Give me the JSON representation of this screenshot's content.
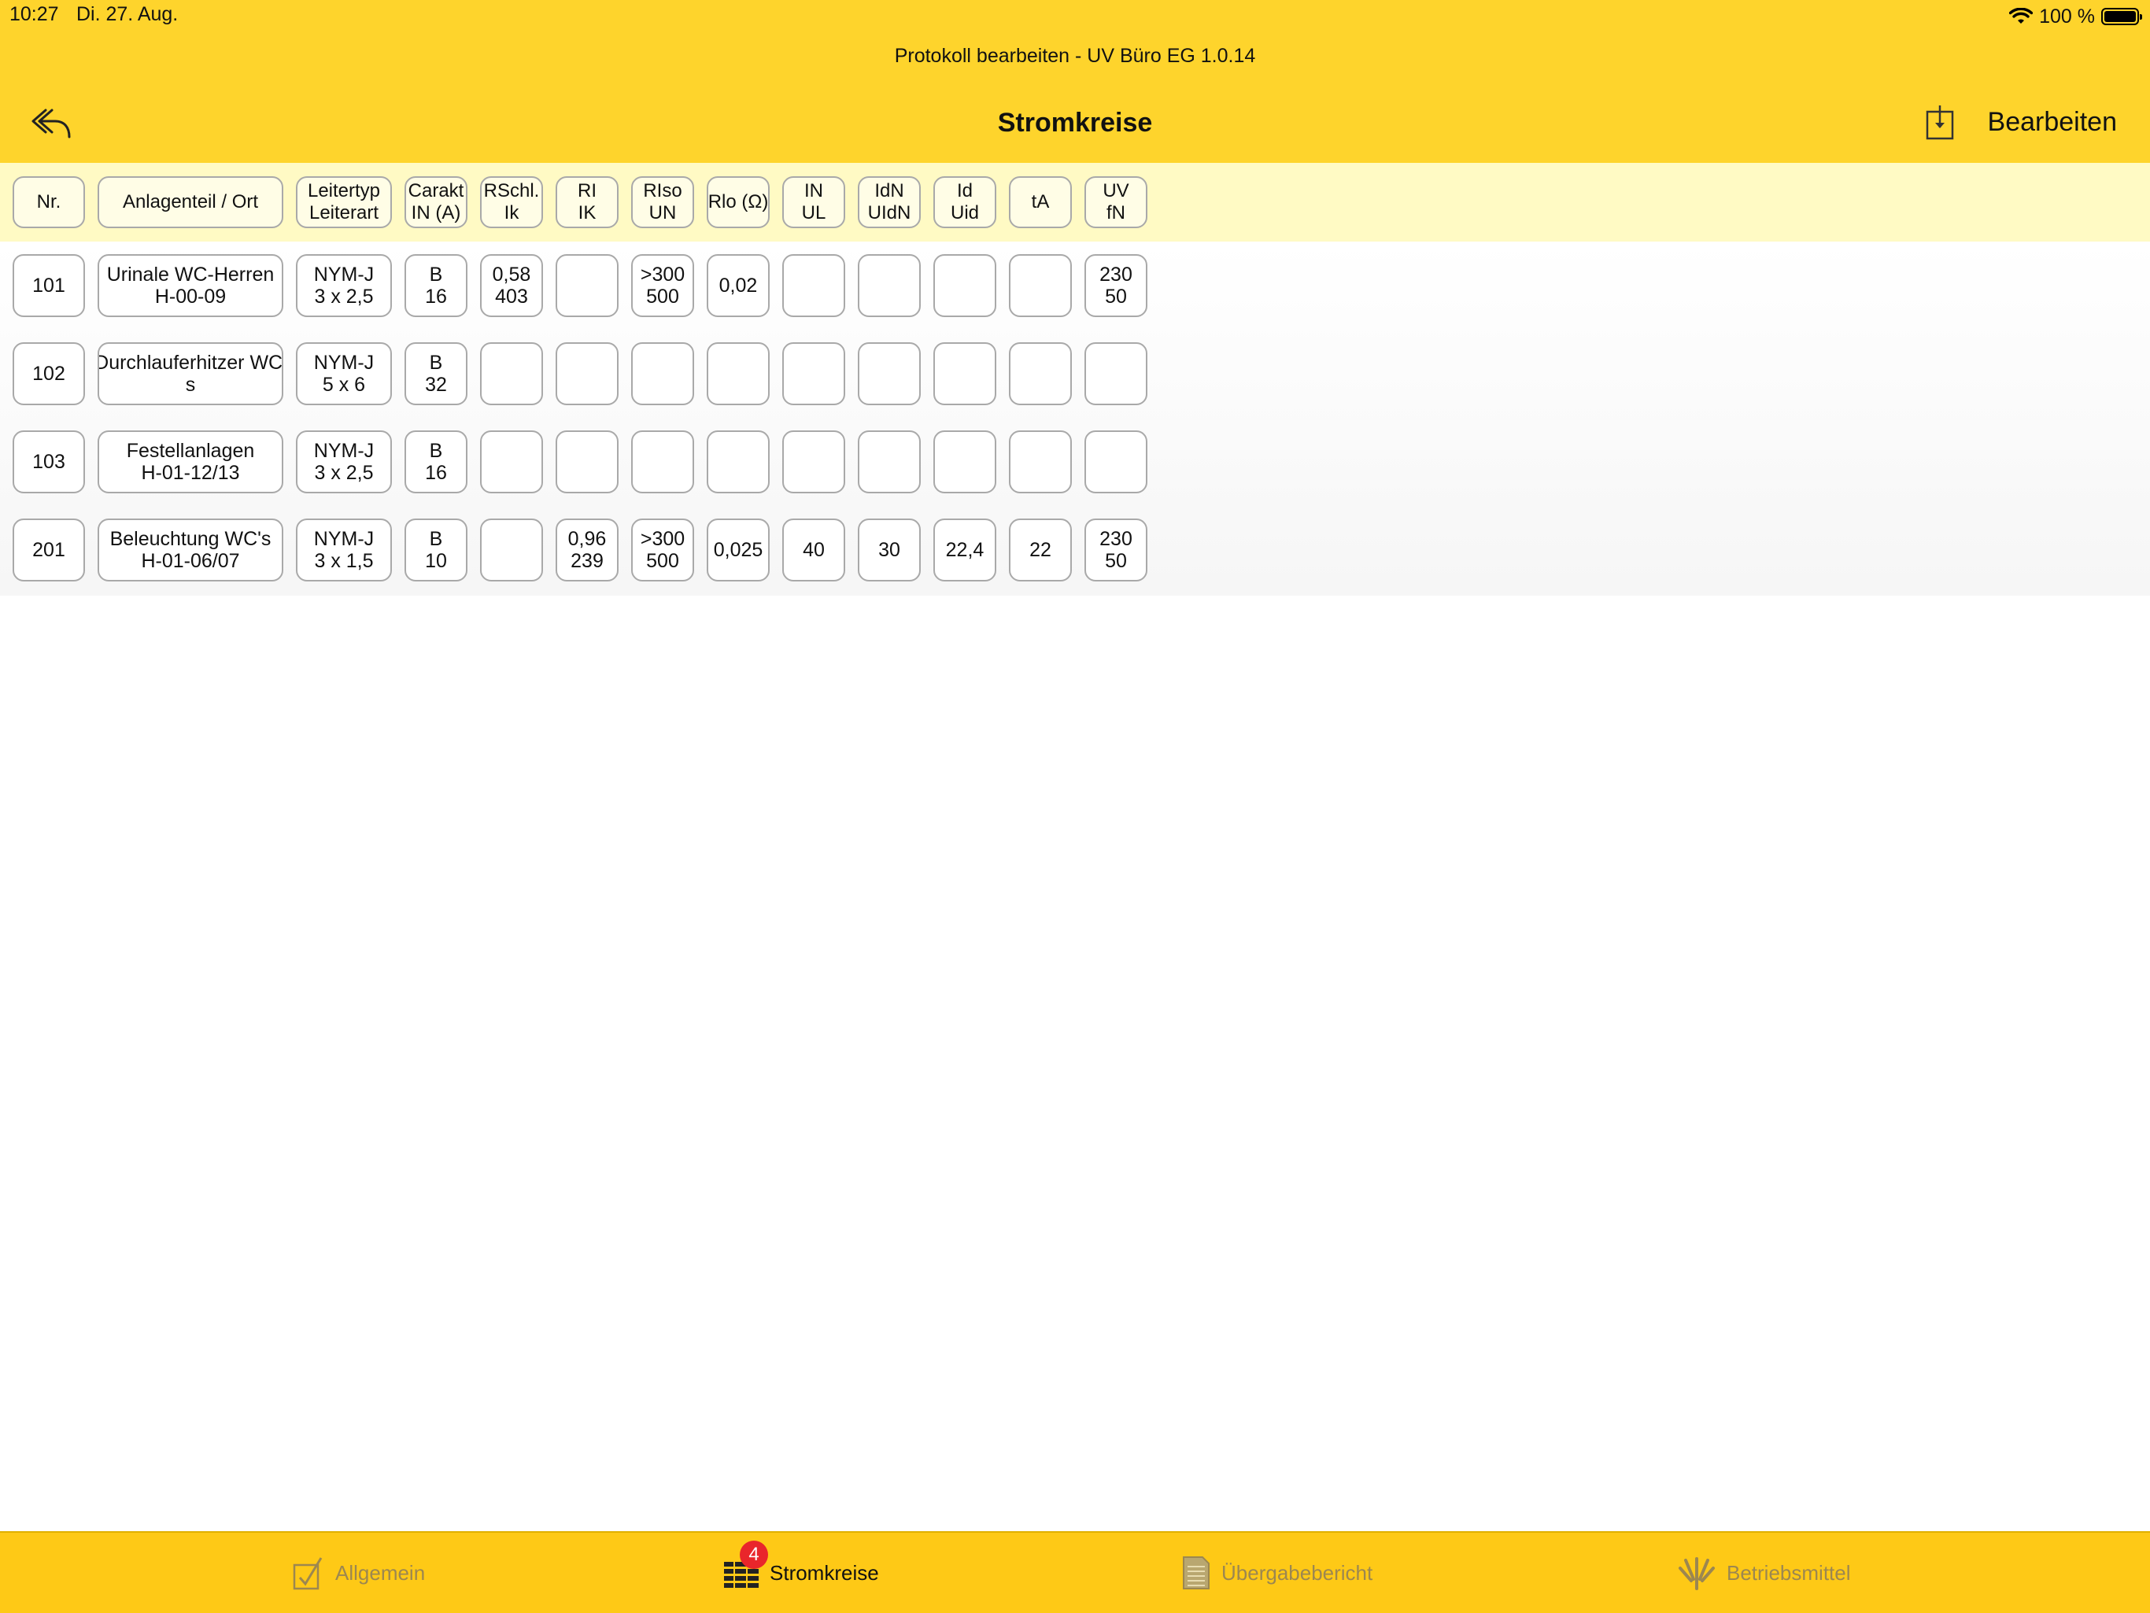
{
  "status": {
    "time": "10:27",
    "date": "Di. 27. Aug.",
    "battery": "100 %"
  },
  "header": {
    "subtitle": "Protokoll bearbeiten - UV Büro EG 1.0.14",
    "title": "Stromkreise",
    "edit_label": "Bearbeiten",
    "back_icon": "reply-arrow-icon",
    "download_icon": "download-box-icon"
  },
  "table": {
    "columns": [
      {
        "l1": "Nr.",
        "l2": ""
      },
      {
        "l1": "Anlagenteil / Ort",
        "l2": ""
      },
      {
        "l1": "Leitertyp",
        "l2": "Leiterart"
      },
      {
        "l1": "Carakt",
        "l2": "IN (A)"
      },
      {
        "l1": "RSchl.",
        "l2": "Ik"
      },
      {
        "l1": "RI",
        "l2": "IK"
      },
      {
        "l1": "RIso",
        "l2": "UN"
      },
      {
        "l1": "Rlo (Ω)",
        "l2": ""
      },
      {
        "l1": "IN",
        "l2": "UL"
      },
      {
        "l1": "IdN",
        "l2": "UIdN"
      },
      {
        "l1": "Id",
        "l2": "Uid"
      },
      {
        "l1": "tA",
        "l2": ""
      },
      {
        "l1": "UV",
        "l2": "fN"
      }
    ],
    "rows": [
      [
        {
          "l1": "101",
          "l2": ""
        },
        {
          "l1": "Urinale WC-Herren",
          "l2": "H-00-09"
        },
        {
          "l1": "NYM-J",
          "l2": "3 x 2,5"
        },
        {
          "l1": "B",
          "l2": "16"
        },
        {
          "l1": "0,58",
          "l2": "403"
        },
        {
          "l1": "",
          "l2": ""
        },
        {
          "l1": ">300",
          "l2": "500"
        },
        {
          "l1": "0,02",
          "l2": ""
        },
        {
          "l1": "",
          "l2": ""
        },
        {
          "l1": "",
          "l2": ""
        },
        {
          "l1": "",
          "l2": ""
        },
        {
          "l1": "",
          "l2": ""
        },
        {
          "l1": "230",
          "l2": "50"
        }
      ],
      [
        {
          "l1": "102",
          "l2": ""
        },
        {
          "l1": "Durchlauferhitzer WC'",
          "l2": "s"
        },
        {
          "l1": "NYM-J",
          "l2": "5 x 6"
        },
        {
          "l1": "B",
          "l2": "32"
        },
        {
          "l1": "",
          "l2": ""
        },
        {
          "l1": "",
          "l2": ""
        },
        {
          "l1": "",
          "l2": ""
        },
        {
          "l1": "",
          "l2": ""
        },
        {
          "l1": "",
          "l2": ""
        },
        {
          "l1": "",
          "l2": ""
        },
        {
          "l1": "",
          "l2": ""
        },
        {
          "l1": "",
          "l2": ""
        },
        {
          "l1": "",
          "l2": ""
        }
      ],
      [
        {
          "l1": "103",
          "l2": ""
        },
        {
          "l1": "Festellanlagen",
          "l2": "H-01-12/13"
        },
        {
          "l1": "NYM-J",
          "l2": "3 x 2,5"
        },
        {
          "l1": "B",
          "l2": "16"
        },
        {
          "l1": "",
          "l2": ""
        },
        {
          "l1": "",
          "l2": ""
        },
        {
          "l1": "",
          "l2": ""
        },
        {
          "l1": "",
          "l2": ""
        },
        {
          "l1": "",
          "l2": ""
        },
        {
          "l1": "",
          "l2": ""
        },
        {
          "l1": "",
          "l2": ""
        },
        {
          "l1": "",
          "l2": ""
        },
        {
          "l1": "",
          "l2": ""
        }
      ],
      [
        {
          "l1": "201",
          "l2": ""
        },
        {
          "l1": "Beleuchtung WC's",
          "l2": "H-01-06/07"
        },
        {
          "l1": "NYM-J",
          "l2": "3 x 1,5"
        },
        {
          "l1": "B",
          "l2": "10"
        },
        {
          "l1": "",
          "l2": ""
        },
        {
          "l1": "0,96",
          "l2": "239"
        },
        {
          "l1": ">300",
          "l2": "500"
        },
        {
          "l1": "0,025",
          "l2": ""
        },
        {
          "l1": "40",
          "l2": ""
        },
        {
          "l1": "30",
          "l2": ""
        },
        {
          "l1": "22,4",
          "l2": ""
        },
        {
          "l1": "22",
          "l2": ""
        },
        {
          "l1": "230",
          "l2": "50"
        }
      ]
    ]
  },
  "tabbar": {
    "tabs": [
      {
        "label": "Allgemein",
        "icon": "checkbox-icon",
        "active": false
      },
      {
        "label": "Stromkreise",
        "icon": "circuits-grid-icon",
        "active": true,
        "badge": "4"
      },
      {
        "label": "Übergabebericht",
        "icon": "document-icon",
        "active": false
      },
      {
        "label": "Betriebsmittel",
        "icon": "tools-icon",
        "active": false
      }
    ]
  },
  "colors": {
    "header_bg": "#fed42c",
    "header_row_bg": "#fffac4",
    "tabbar_bg": "#fec916",
    "badge": "#e9262b"
  }
}
